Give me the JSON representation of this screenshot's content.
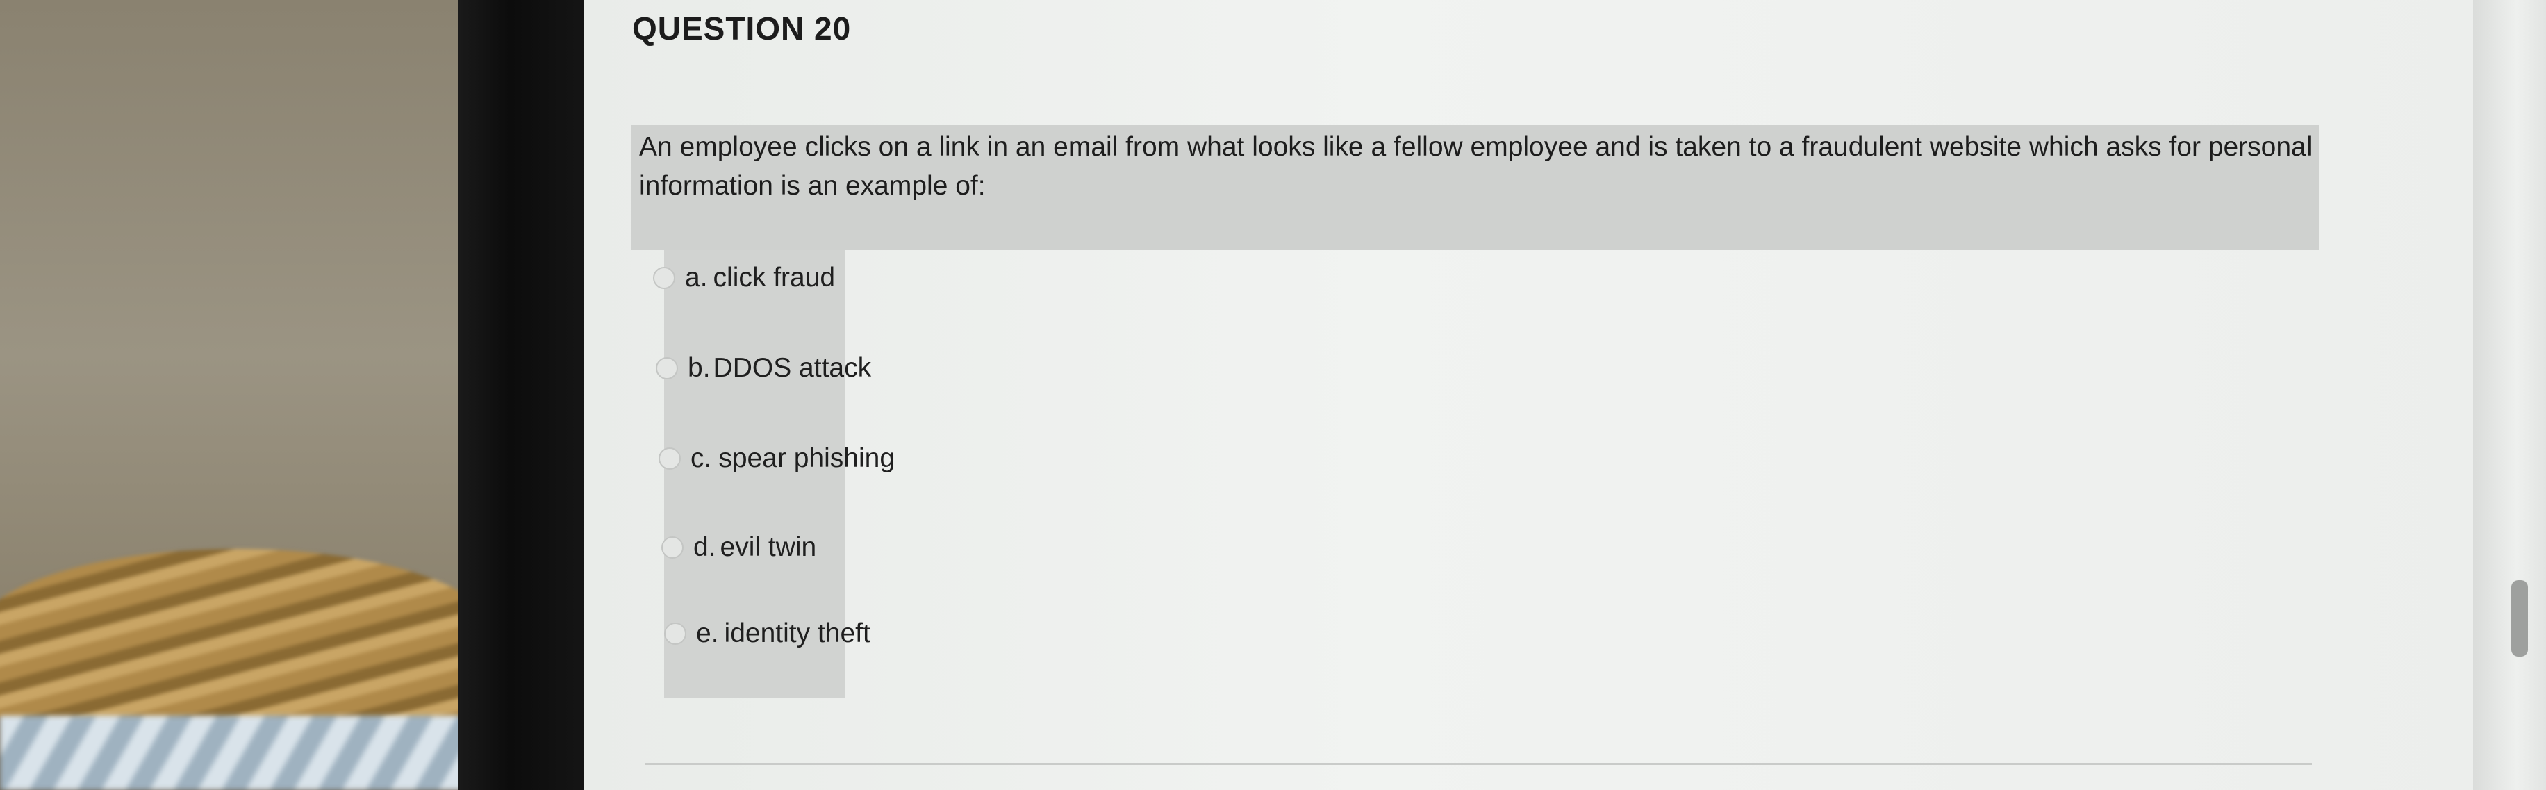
{
  "question": {
    "title": "QUESTION 20",
    "text": "An employee clicks on a link in an email from what looks like a fellow employee and is taken to a fraudulent website which asks for personal information is an example of:"
  },
  "options": [
    {
      "letter": "a.",
      "label": "click fraud"
    },
    {
      "letter": "b.",
      "label": "DDOS attack"
    },
    {
      "letter": "c.",
      "label": "spear phishing"
    },
    {
      "letter": "d.",
      "label": "evil twin"
    },
    {
      "letter": "e.",
      "label": "identity theft"
    }
  ],
  "colors": {
    "screen_bg": "#eceeec",
    "question_box": "#cfd1cf",
    "text": "#1d1d1d"
  }
}
